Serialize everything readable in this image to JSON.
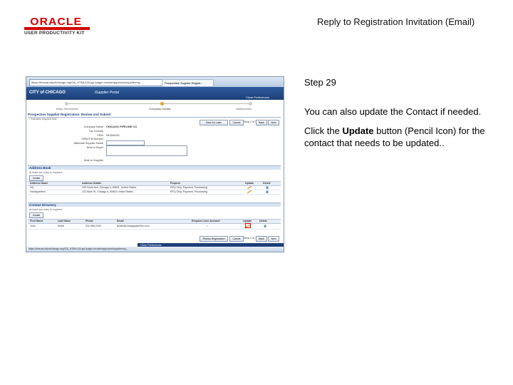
{
  "logo": {
    "brand": "ORACLE",
    "sub": "USER PRODUCTIVITY KIT"
  },
  "header": {
    "title": "Reply to Registration Invitation (Email)"
  },
  "step": {
    "label": "Step 29"
  },
  "instructions": {
    "para1": "You can also update the Contact if needed.",
    "para2_pre": "Click the ",
    "para2_bold": "Update",
    "para2_post": " button (Pencil Icon) for the contact that needs to be updated.."
  },
  "colors": {
    "oracle_red": "#d00000",
    "app_blue": "#1c3f78",
    "highlight_red": "#e00000"
  },
  "screenshot": {
    "url": "https://ebsuat.cityofchicago.org/OA_HTML/OA.jsp?page=/oracle/apps/pos/supplierreg...",
    "tab": "Prospective Supplier Registr...",
    "app_logo": "CITY of CHICAGO",
    "app_title": "iSupplier Portal",
    "app_links": "Close   Preferences",
    "train": [
      "Basic Information",
      "Company Details",
      "Attachments"
    ],
    "page_heading": "Prospective Supplier Registration: Review and Submit",
    "indicator": "* Indicates required field",
    "buttons": {
      "save": "Save for Later",
      "cancel": "Cancel",
      "step": "Step 2 of 3",
      "back": "Back",
      "next": "Next",
      "review": "Review Registration"
    },
    "form": [
      {
        "label": "Company Name",
        "value": "CHICAGO PIPELINE CO"
      },
      {
        "label": "Tax Country",
        "value": ""
      },
      {
        "label": "FEIN",
        "value": "987654321"
      },
      {
        "label": "SSN/ITIN Number",
        "value": ""
      },
      {
        "label": "Alternate Supplier Name",
        "value": ""
      },
      {
        "label": "Note to Buyer",
        "value": ""
      },
      {
        "label": "Note to Supplier",
        "value": ""
      }
    ],
    "address_section": "Address Book",
    "address_note": "At least one entry is required.",
    "address_create": "Create",
    "address_headers": [
      "Address Name",
      "Address Details",
      "Purpose",
      "Update",
      "Delete"
    ],
    "address_rows": [
      [
        "HQ",
        "333 North Ave, Chicago IL 60601, United States",
        "RFQ Only, Payment, Purchasing"
      ],
      [
        "Headquarters",
        "123 Main St, Chicago IL 60602 United States",
        "RFQ Only, Payment, Purchasing"
      ]
    ],
    "contact_section": "Contact Directory",
    "contact_note": "At least one entry is required.",
    "contact_create": "Create",
    "contact_headers": [
      "First Name",
      "Last Name",
      "Phone",
      "Email",
      "Requires User Account",
      "Update",
      "Delete"
    ],
    "contact_rows": [
      [
        "John",
        "Smith",
        "312-555-0100",
        "jsmith@chicagopipeline.com",
        "✓"
      ]
    ],
    "footer_links": "Close   Preferences",
    "status": "https://ebsuat.cityofchicago.org/OA_HTML/OA.jsp?page=/oracle/apps/pos/supplierreg..."
  }
}
